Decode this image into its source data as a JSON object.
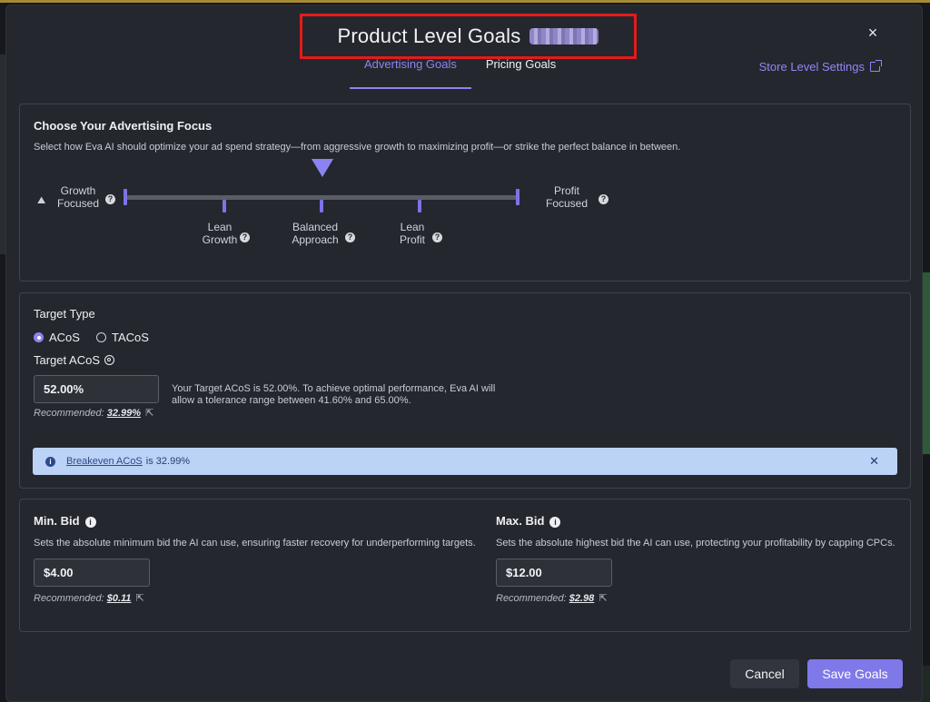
{
  "modal": {
    "title": "Product Level Goals",
    "close": "×",
    "tabs": [
      {
        "label": "Advertising Goals",
        "active": true
      },
      {
        "label": "Pricing Goals",
        "active": false
      }
    ],
    "store_link": "Store Level Settings"
  },
  "focus": {
    "heading": "Choose Your Advertising Focus",
    "description": "Select how Eva AI should optimize your ad spend strategy—from aggressive growth to maximizing profit—or strike the perfect balance in between.",
    "left_label_1": "Growth",
    "left_label_2": "Focused",
    "right_label_1": "Profit",
    "right_label_2": "Focused",
    "stops": [
      {
        "l1": "Lean",
        "l2": "Growth"
      },
      {
        "l1": "Balanced",
        "l2": "Approach"
      },
      {
        "l1": "Lean",
        "l2": "Profit"
      }
    ],
    "selected": "Balanced Approach"
  },
  "target": {
    "heading": "Target Type",
    "options": [
      "ACoS",
      "TACoS"
    ],
    "selected": "ACoS",
    "acos_label": "Target ACoS",
    "acos_value": "52.00%",
    "recommended_label": "Recommended:",
    "recommended_value": "32.99%",
    "explain_1": "Your Target ACoS is 52.00%. To achieve optimal performance, Eva AI will",
    "explain_2": "allow a tolerance range between 41.60% and 65.00%.",
    "alert_link": "Breakeven ACoS",
    "alert_text": "is 32.99%"
  },
  "bids": {
    "min": {
      "label": "Min. Bid",
      "description": "Sets the absolute minimum bid the AI can use, ensuring faster recovery for underperforming targets.",
      "value": "$4.00",
      "recommended_label": "Recommended:",
      "recommended_value": "$0.11"
    },
    "max": {
      "label": "Max. Bid",
      "description": "Sets the absolute highest bid the AI can use, protecting your profitability by capping CPCs.",
      "value": "$12.00",
      "recommended_label": "Recommended:",
      "recommended_value": "$2.98"
    }
  },
  "footer": {
    "cancel": "Cancel",
    "save": "Save Goals"
  },
  "colors": {
    "accent": "#8b84f0",
    "highlight_box": "#e31b1b",
    "alert_bg": "#bcd2f6"
  }
}
